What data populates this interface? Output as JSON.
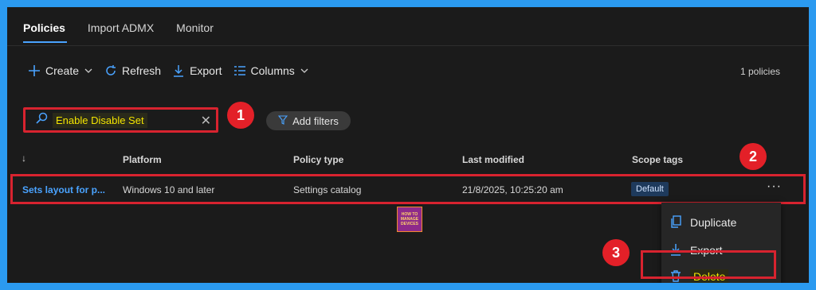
{
  "tabs": [
    {
      "label": "Policies",
      "active": true
    },
    {
      "label": "Import ADMX",
      "active": false
    },
    {
      "label": "Monitor",
      "active": false
    }
  ],
  "toolbar": {
    "create_label": "Create",
    "refresh_label": "Refresh",
    "export_label": "Export",
    "columns_label": "Columns",
    "count_text": "1 policies"
  },
  "search": {
    "value": "Enable Disable Set"
  },
  "filters": {
    "add_label": "Add filters"
  },
  "table": {
    "sort_glyph": "↓",
    "headers": {
      "platform": "Platform",
      "policy_type": "Policy type",
      "last_modified": "Last modified",
      "scope_tags": "Scope tags"
    },
    "rows": [
      {
        "name": "Sets layout for p...",
        "platform": "Windows 10 and later",
        "policy_type": "Settings catalog",
        "last_modified": "21/8/2025, 10:25:20 am",
        "scope_tag": "Default"
      }
    ]
  },
  "context_menu": {
    "items": [
      {
        "label": "Duplicate",
        "icon": "duplicate-icon"
      },
      {
        "label": "Export",
        "icon": "download-icon"
      },
      {
        "label": "Delete",
        "icon": "trash-icon"
      }
    ]
  },
  "annotations": {
    "badge_1": "1",
    "badge_2": "2",
    "badge_3": "3"
  },
  "logo": {
    "line1": "HOW TO",
    "line2": "MANAGE",
    "line3": "DEVICES"
  },
  "colors": {
    "background": "#1b1b1b",
    "frame_border": "#2b9af0",
    "accent": "#4aa3ff",
    "annotation_red": "#d8232f",
    "highlight_yellow": "#f4e500"
  }
}
